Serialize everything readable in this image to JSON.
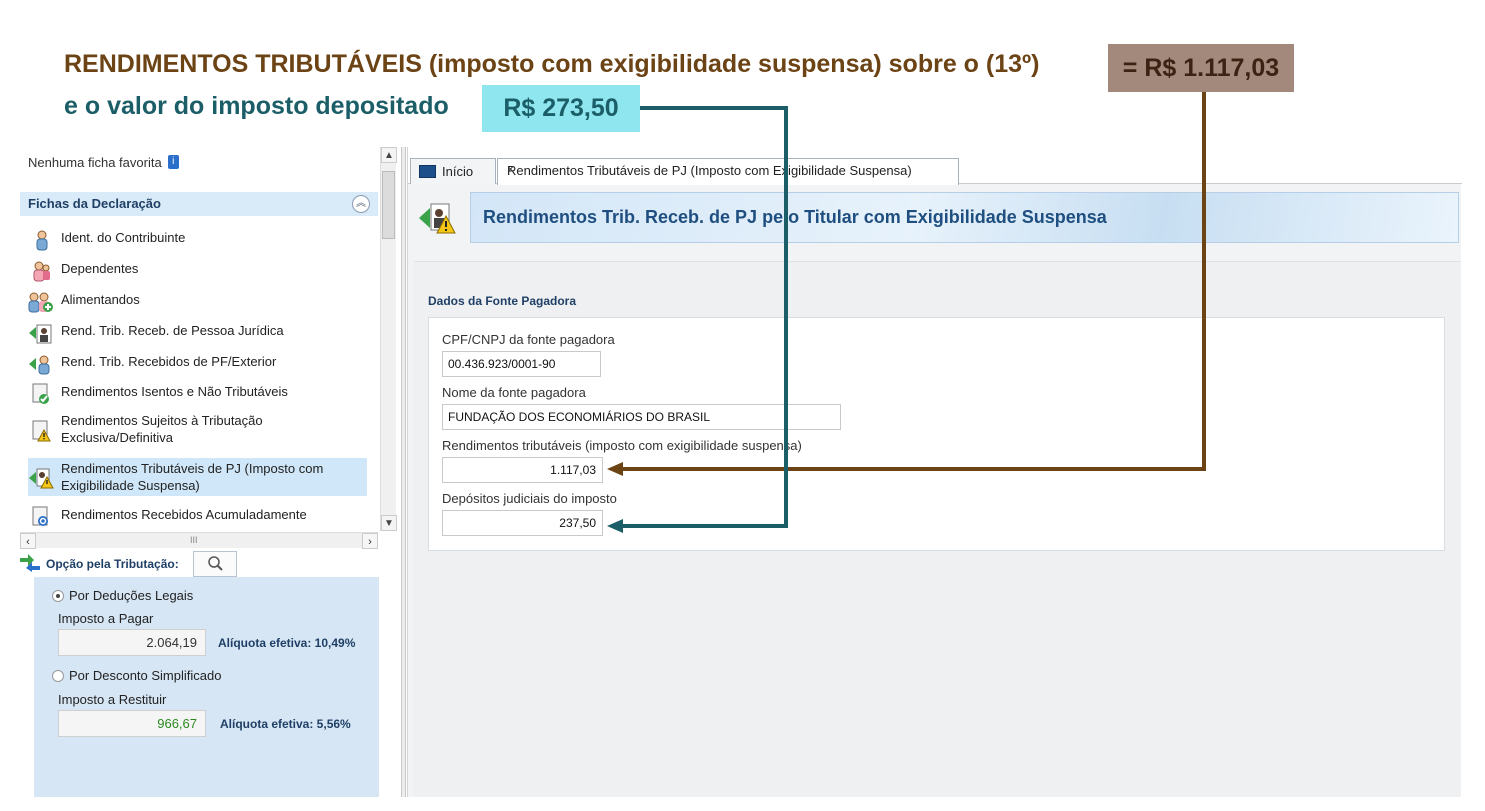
{
  "annotation": {
    "line1": "RENDIMENTOS TRIBUTÁVEIS (imposto com exigibilidade suspensa) sobre o (13º)",
    "line1_value": "= R$ 1.117,03",
    "line2": "e o valor do imposto depositado",
    "line2_value": "R$ 273,50",
    "color_brown": "#6b4314",
    "color_teal": "#1b5e67"
  },
  "left_panel": {
    "favorites_text": "Nenhuma ficha favorita",
    "section_title": "Fichas da Declaração",
    "nav_items": [
      {
        "label": "Ident. do Contribuinte",
        "icon": "person-icon"
      },
      {
        "label": "Dependentes",
        "icon": "dependents-icon"
      },
      {
        "label": "Alimentandos",
        "icon": "alimentandos-icon"
      },
      {
        "label": "Rend. Trib. Receb. de Pessoa Jurídica",
        "icon": "income-pj-icon"
      },
      {
        "label": "Rend. Trib. Recebidos de PF/Exterior",
        "icon": "income-pf-icon"
      },
      {
        "label": "Rendimentos Isentos e Não Tributáveis",
        "icon": "exempt-income-icon"
      },
      {
        "label": "Rendimentos Sujeitos à Tributação",
        "label2": "Exclusiva/Definitiva",
        "icon": "exclusive-tax-icon"
      },
      {
        "label": "Rendimentos Tributáveis de PJ (Imposto com",
        "label2": "Exigibilidade Suspensa)",
        "icon": "suspended-tax-icon"
      },
      {
        "label": "Rendimentos Recebidos Acumuladamente",
        "icon": "accumulated-income-icon"
      }
    ],
    "opcao_label": "Opção pela Tributação:",
    "deducoes_label": "Por Deduções Legais",
    "imposto_pagar_label": "Imposto a Pagar",
    "imposto_pagar_value": "2.064,19",
    "aliquota_1": "Alíquota efetiva: 10,49%",
    "simplificado_label": "Por Desconto Simplificado",
    "imposto_restituir_label": "Imposto a Restituir",
    "imposto_restituir_value": "966,67",
    "aliquota_2": "Alíquota efetiva: 5,56%"
  },
  "tabs": {
    "home": "Início",
    "active": "Rendimentos Tributáveis de PJ (Imposto com Exigibilidade Suspensa)",
    "close": "×"
  },
  "main": {
    "banner_title": "Rendimentos Trib. Receb. de PJ pelo Titular com Exigibilidade Suspensa",
    "section_title": "Dados da Fonte Pagadora",
    "cpf_label": "CPF/CNPJ da fonte pagadora",
    "cpf_value": "00.436.923/0001-90",
    "nome_label": "Nome da fonte pagadora",
    "nome_value": "FUNDAÇÃO DOS ECONOMIÁRIOS DO BRASIL",
    "rend_label": "Rendimentos tributáveis (imposto com exigibilidade suspensa)",
    "rend_value": "1.117,03",
    "dep_label": "Depósitos judiciais do imposto",
    "dep_value": "237,50"
  }
}
